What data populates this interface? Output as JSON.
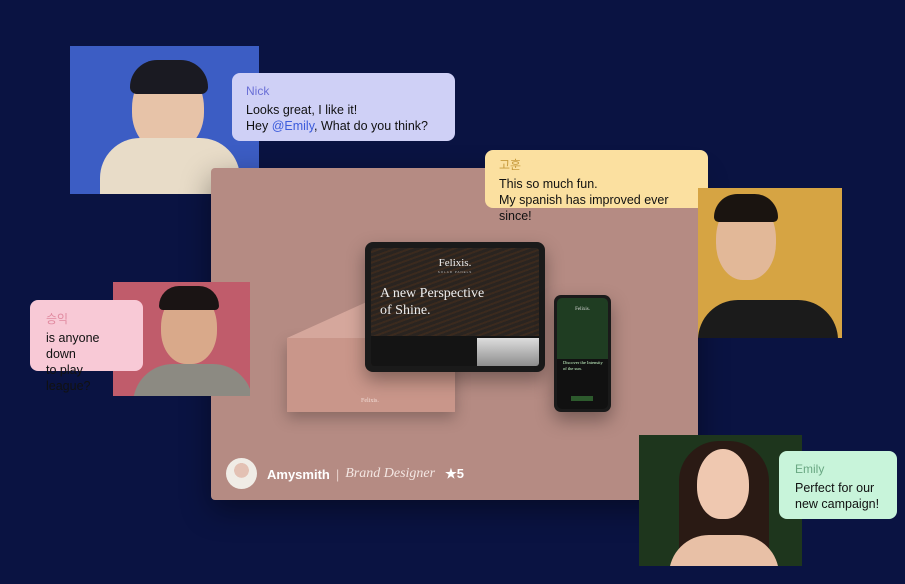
{
  "messages": [
    {
      "name": "Nick",
      "lines": [
        "Looks great, I like it!",
        "Hey "
      ],
      "mention": "@Emily",
      "after": ", What do you think?"
    },
    {
      "name": "고훈",
      "lines": [
        "This so much fun.",
        "My spanish has improved ever since!"
      ]
    },
    {
      "name": "승익",
      "lines": [
        "is anyone down",
        "to play league?"
      ]
    },
    {
      "name": "Emily",
      "lines": [
        "Perfect for our",
        "new campaign!"
      ]
    }
  ],
  "card": {
    "author": "Amysmith",
    "separator": "|",
    "role": "Brand Designer",
    "rating": "★5",
    "tablet": {
      "brand": "Felixis.",
      "tagline": "SOLAR PANELS",
      "headline1": "A new Perspective",
      "headline2": "of Shine."
    },
    "phone": {
      "brand": "Felixis.",
      "headline": "Discover the Intensity of the sun."
    },
    "envelope_brand": "Felixis."
  },
  "colors": {
    "background": "#0a1342",
    "card": "#b58b83",
    "mention": "#3b5bdb"
  }
}
